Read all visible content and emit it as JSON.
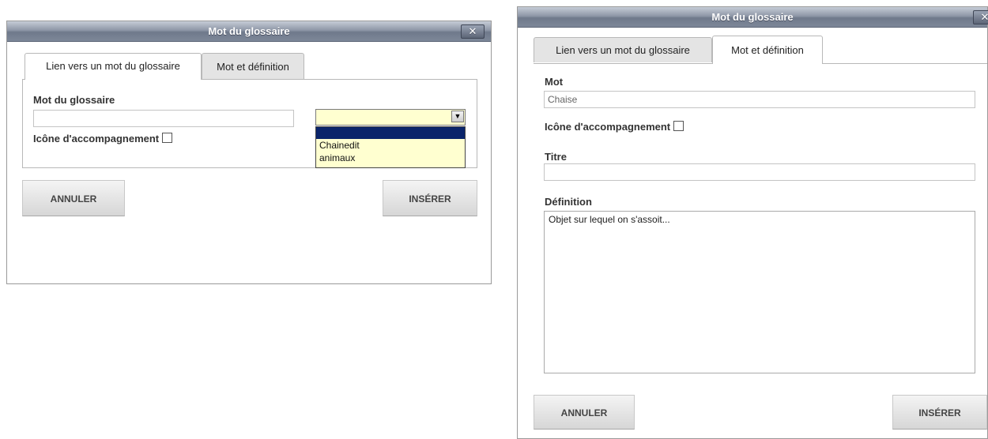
{
  "left_dialog": {
    "title": "Mot du glossaire",
    "close_glyph": "✕",
    "tabs": [
      {
        "label": "Lien vers un mot du glossaire",
        "active": true
      },
      {
        "label": "Mot et définition",
        "active": false
      }
    ],
    "word_label": "Mot du glossaire",
    "word_value": "",
    "icon_label": "Icône d'accompagnement",
    "dropdown": {
      "selected": "",
      "options": [
        "",
        "Chainedit",
        "animaux"
      ]
    },
    "cancel_label": "ANNULER",
    "insert_label": "INSÉRER"
  },
  "right_dialog": {
    "title": "Mot du glossaire",
    "close_glyph": "✕",
    "tabs": [
      {
        "label": "Lien vers un mot du glossaire",
        "active": false
      },
      {
        "label": "Mot et définition",
        "active": true
      }
    ],
    "word_label": "Mot",
    "word_value": "Chaise",
    "icon_label": "Icône d'accompagnement",
    "title_label": "Titre",
    "title_value": "",
    "definition_label": "Définition",
    "definition_value": "Objet sur lequel on s'assoit...",
    "cancel_label": "ANNULER",
    "insert_label": "INSÉRER"
  },
  "colors": {
    "titlebar": "#7d8798",
    "dropdown_bg": "#ffffd0",
    "dropdown_selected": "#0a246a"
  }
}
